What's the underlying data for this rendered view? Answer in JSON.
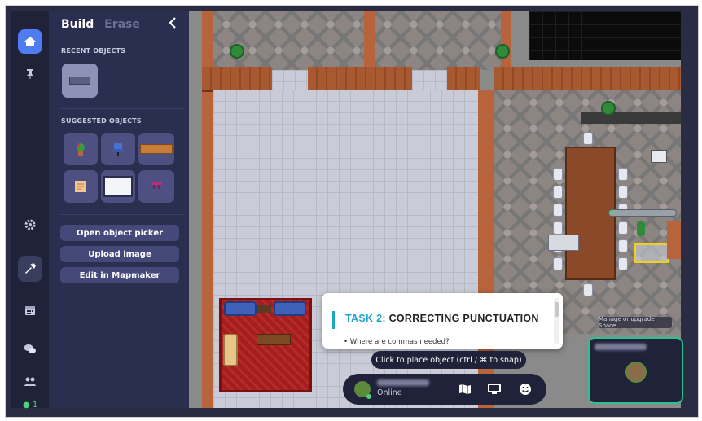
{
  "panel": {
    "tab_build": "Build",
    "tab_erase": "Erase",
    "recent_heading": "RECENT OBJECTS",
    "suggested_heading": "SUGGESTED OBJECTS",
    "open_picker": "Open object picker",
    "upload_image": "Upload image",
    "edit_mapmaker": "Edit in Mapmaker"
  },
  "rail": {
    "participant_count": "● 1"
  },
  "task": {
    "number": "TASK 2:",
    "title": "CORRECTING PUNCTUATION",
    "question": "• Where are commas needed?"
  },
  "hint": "Click to place object (ctrl / ⌘ to snap)",
  "status": "Online",
  "manage": "Manage or upgrade Space",
  "icons": {
    "home": "home-icon",
    "pin": "pin-icon",
    "settings": "gear-icon",
    "build": "hammer-icon",
    "calendar": "calendar-icon",
    "chat": "chat-icon",
    "people": "people-icon",
    "map": "map-icon",
    "screen": "screen-share-icon",
    "emoji": "emoji-icon"
  },
  "colors": {
    "accent": "#4f7cf1",
    "rail": "#1f2239",
    "panel": "#2b2f4f",
    "online": "#4fd07a",
    "task_accent": "#1da6c9",
    "selection": "#f0d21c"
  }
}
